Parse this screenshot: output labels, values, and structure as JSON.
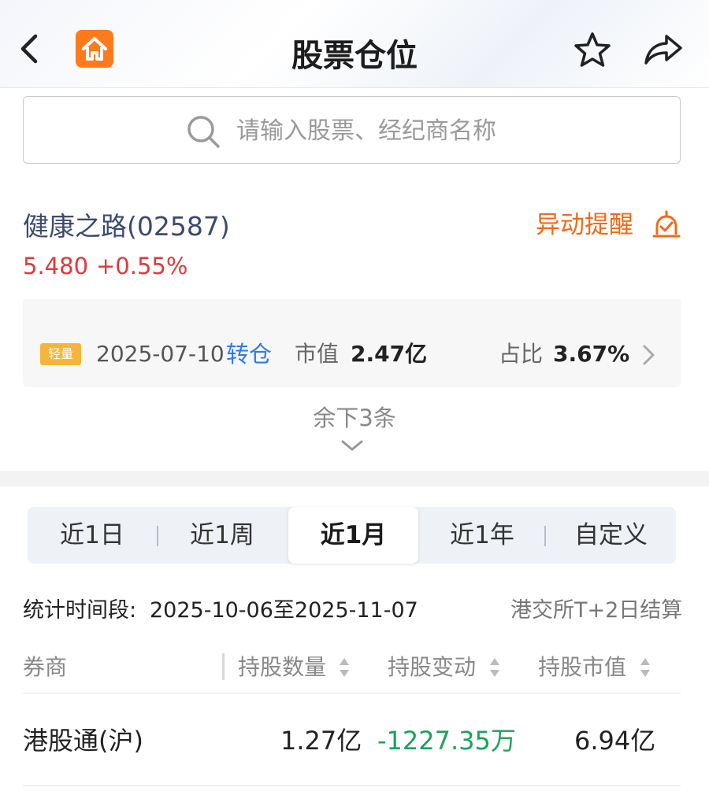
{
  "header": {
    "title": "股票仓位"
  },
  "search": {
    "placeholder": "请输入股票、经纪商名称"
  },
  "stock": {
    "name": "健康之路(02587)",
    "price": "5.480",
    "change_pct": "+0.55%",
    "alert_label": "异动提醒"
  },
  "alerts": [
    {
      "badge": "轻量",
      "date": "2025-07-10",
      "type": "转仓",
      "mv_label": "市值",
      "market_value": "2.47亿",
      "ratio_label": "占比",
      "ratio": "3.67%"
    }
  ],
  "more": {
    "label": "余下3条"
  },
  "tabs": [
    {
      "label": "近1日"
    },
    {
      "label": "近1周"
    },
    {
      "label": "近1月"
    },
    {
      "label": "近1年"
    },
    {
      "label": "自定义"
    }
  ],
  "active_tab": "近1月",
  "stats": {
    "period_label": "统计时间段:",
    "period_value": "2025-10-06至2025-11-07",
    "settle_note": "港交所T+2日结算"
  },
  "table": {
    "headers": {
      "broker": "券商",
      "shares": "持股数量",
      "change": "持股变动",
      "value": "持股市值"
    },
    "rows": [
      {
        "broker": "港股通(沪)",
        "shares": "1.27亿",
        "change": "-1227.35万",
        "value": "6.94亿"
      }
    ]
  },
  "colors": {
    "accent": "#ff7a1a",
    "up": "#e33838",
    "down": "#1aa35a",
    "link": "#2b7bf0"
  }
}
